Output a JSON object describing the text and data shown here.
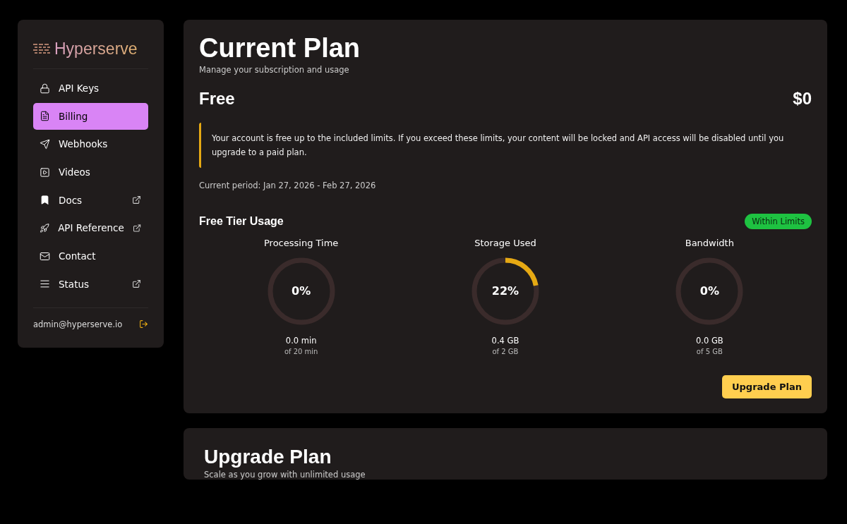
{
  "sidebar": {
    "brand": "Hyperserve",
    "items": [
      {
        "label": "API Keys",
        "selected": false,
        "external": false
      },
      {
        "label": "Billing",
        "selected": true,
        "external": false
      },
      {
        "label": "Webhooks",
        "selected": false,
        "external": false
      },
      {
        "label": "Videos",
        "selected": false,
        "external": false
      },
      {
        "label": "Docs",
        "selected": false,
        "external": true
      },
      {
        "label": "API Reference",
        "selected": false,
        "external": true
      },
      {
        "label": "Contact",
        "selected": false,
        "external": false
      },
      {
        "label": "Status",
        "selected": false,
        "external": true
      }
    ],
    "user_email": "admin@hyperserve.io"
  },
  "current_plan": {
    "title": "Current Plan",
    "subtitle": "Manage your subscription and usage",
    "plan_name": "Free",
    "price": "$0",
    "notice": "Your account is free up to the included limits. If you exceed these limits, your content will be locked and API access will be disabled until you upgrade to a paid plan.",
    "period": "Current period: Jan 27, 2026 - Feb 27, 2026",
    "usage_title": "Free Tier Usage",
    "status_badge": "Within Limits",
    "meters": [
      {
        "label": "Processing Time",
        "level": 0,
        "reading": "0%",
        "used": "0.0 min",
        "limit": "of 20 min"
      },
      {
        "label": "Storage Used",
        "level": 0.22,
        "reading": "22%",
        "used": "0.4 GB",
        "limit": "of 2 GB"
      },
      {
        "label": "Bandwidth",
        "level": 0,
        "reading": "0%",
        "used": "0.0 GB",
        "limit": "of 5 GB"
      }
    ],
    "button": "Upgrade Plan"
  },
  "upgrade_plan": {
    "title": "Upgrade Plan",
    "subtitle": "Scale as you grow with unlimited usage"
  }
}
